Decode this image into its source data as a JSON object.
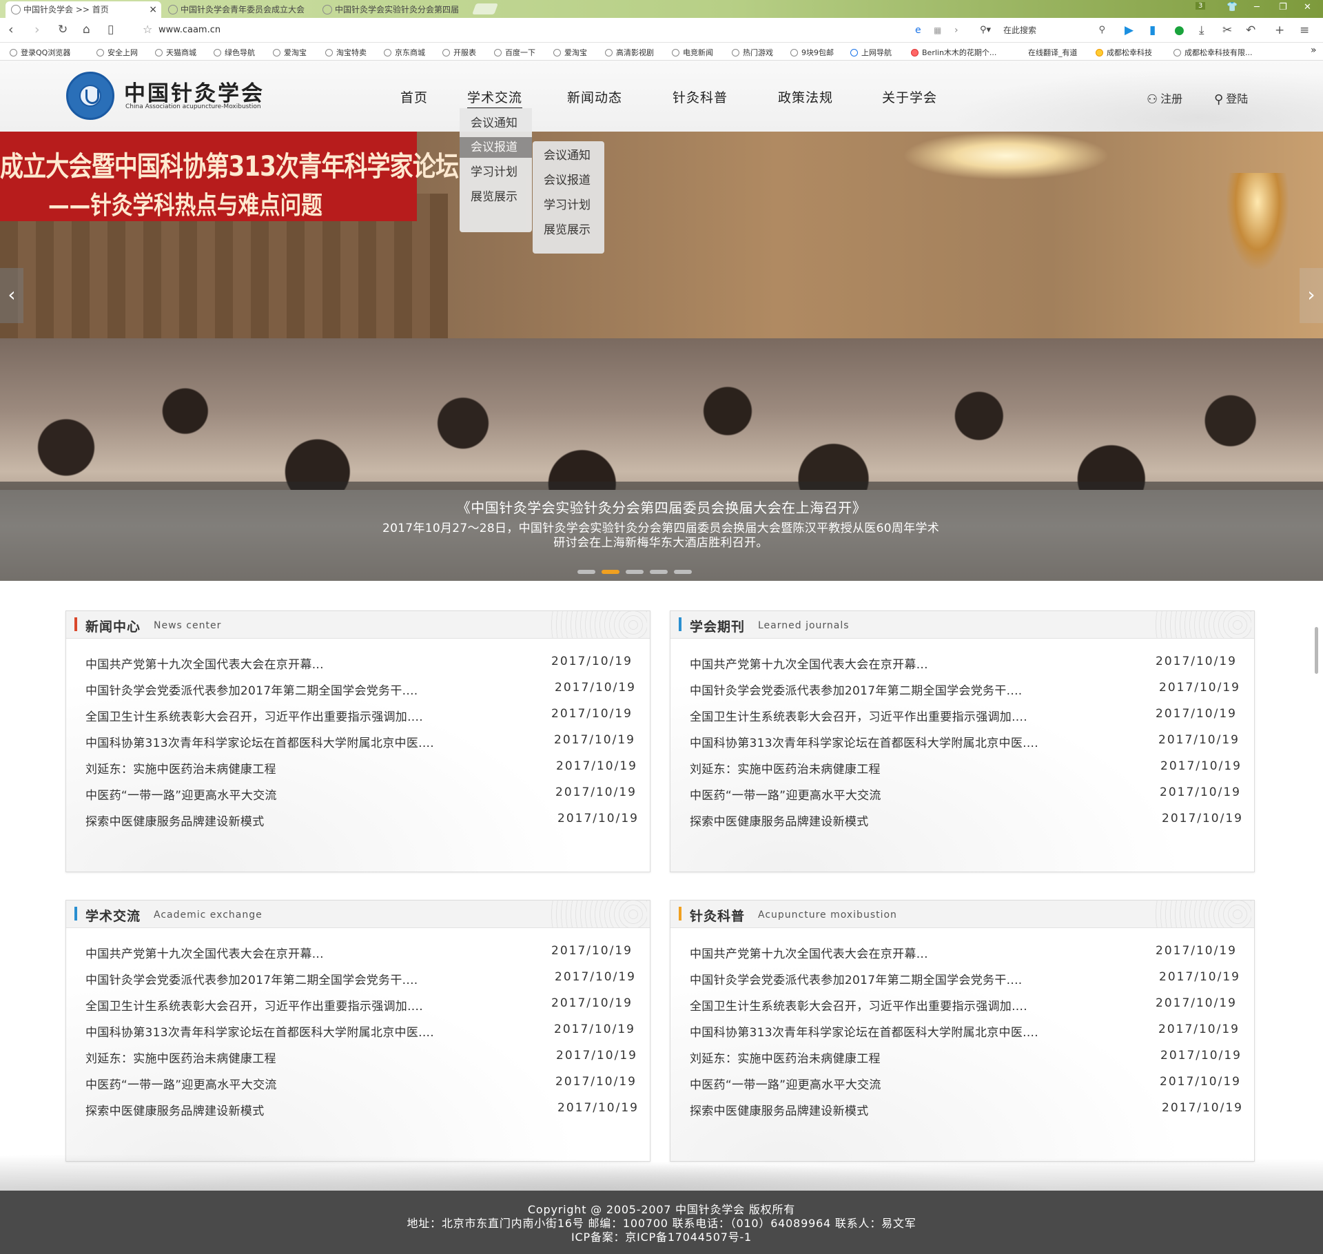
{
  "browser": {
    "tabs": [
      {
        "label": "中国针灸学会 >> 首页"
      },
      {
        "label": "中国针灸学会青年委员会成立大会"
      },
      {
        "label": "中国针灸学会实验针灸分会第四届"
      }
    ],
    "tab_count": "3",
    "url": "www.caam.cn",
    "search_placeholder": "在此搜索",
    "bookmarks": [
      "登录QQ浏览器",
      "安全上网",
      "天猫商城",
      "绿色导航",
      "爱淘宝",
      "淘宝特卖",
      "京东商城",
      "开服表",
      "百度一下",
      "爱淘宝",
      "高清影视剧",
      "电竞新闻",
      "热门游戏",
      "9块9包邮",
      "上网导航",
      "Berlin木木的花期个...",
      "在线翻译_有道",
      "成都松幸科技",
      "成都松幸科技有限..."
    ]
  },
  "site": {
    "logo_cn": "中国针灸学会",
    "logo_en": "China Association acupuncture-Moxibustion",
    "nav": [
      "首页",
      "学术交流",
      "新闻动态",
      "针灸科普",
      "政策法规",
      "关于学会"
    ],
    "register": "注册",
    "login": "登陆",
    "dropdown1": [
      "会议通知",
      "会议报道",
      "学习计划",
      "展览展示"
    ],
    "dropdown2": [
      "会议通知",
      "会议报道",
      "学习计划",
      "展览展示"
    ]
  },
  "banner": {
    "photo_banner_line1": "成立大会暨中国科协第313次青年科学家论坛",
    "photo_banner_line2": "——针灸学科热点与难点问题",
    "caption_title": "《中国针灸学会实验针灸分会第四届委员会换届大会在上海召开》",
    "caption_text": "2017年10月27～28日，中国针灸学会实验针灸分会第四届委员会换届大会暨陈汉平教授从医60周年学术研讨会在上海新梅华东大酒店胜利召开。",
    "active_slide": 2,
    "slide_count": 5
  },
  "panels": [
    {
      "title_cn": "新闻中心",
      "title_en": "News center",
      "accent": "#d9472b"
    },
    {
      "title_cn": "学会期刊",
      "title_en": "Learned journals",
      "accent": "#2a8fd0"
    },
    {
      "title_cn": "学术交流",
      "title_en": "Academic exchange",
      "accent": "#2a8fd0"
    },
    {
      "title_cn": "针灸科普",
      "title_en": "Acupuncture  moxibustion",
      "accent": "#f0a020"
    }
  ],
  "news_items": [
    {
      "title": "中国共产党第十九次全国代表大会在京开幕...",
      "date": "2017/10/19"
    },
    {
      "title": "中国针灸学会党委派代表参加2017年第二期全国学会党务干....",
      "date": "2017/10/19"
    },
    {
      "title": "全国卫生计生系统表彰大会召开，习近平作出重要指示强调加....",
      "date": "2017/10/19"
    },
    {
      "title": "中国科协第313次青年科学家论坛在首都医科大学附属北京中医....",
      "date": "2017/10/19"
    },
    {
      "title": "刘延东：实施中医药治未病健康工程",
      "date": "2017/10/19"
    },
    {
      "title": "中医药“一带一路”迎更高水平大交流",
      "date": "2017/10/19"
    },
    {
      "title": "探索中医健康服务品牌建设新模式",
      "date": "2017/10/19"
    }
  ],
  "footer": {
    "line1": "Copyright @ 2005-2007 中国针灸学会 版权所有",
    "line2": "地址：北京市东直门内南小街16号 邮编：100700 联系电话：（010）64089964 联系人：易文军",
    "line3": "ICP备案：京ICP备17044507号-1"
  }
}
